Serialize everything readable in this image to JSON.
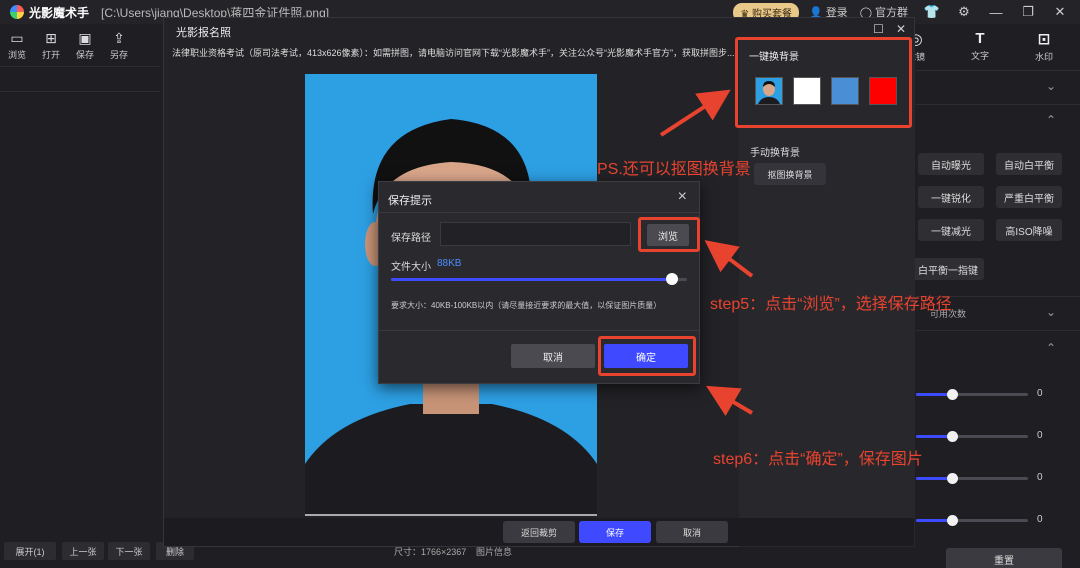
{
  "titlebar": {
    "app_name": "光影魔术手",
    "file_path": "[C:\\Users\\jiang\\Desktop\\蒋四金证件照.png]",
    "vip_label": "购买套餐",
    "login_label": "登录",
    "group_label": "官方群"
  },
  "toolbar": {
    "items": [
      {
        "label": "浏览",
        "icon": "folder-icon"
      },
      {
        "label": "打开",
        "icon": "open-image-icon"
      },
      {
        "label": "保存",
        "icon": "save-icon"
      },
      {
        "label": "另存",
        "icon": "save-as-icon"
      }
    ]
  },
  "right_panel": {
    "tools": [
      {
        "label": "滤镜",
        "icon": "filter-icon"
      },
      {
        "label": "文字",
        "icon": "text-icon"
      },
      {
        "label": "水印",
        "icon": "watermark-icon"
      }
    ],
    "buttons": [
      "自动曝光",
      "自动白平衡",
      "一键锐化",
      "严重白平衡",
      "一键减光",
      "高ISO降噪"
    ],
    "wb_button": "白平衡一指键",
    "usage_note": "可用次数",
    "slider_values": [
      "0",
      "0",
      "0",
      "0"
    ],
    "reset_label": "重置"
  },
  "bottom": {
    "expand_label": "展开(1)",
    "prev_label": "上一张",
    "next_label": "下一张",
    "delete_label": "删除",
    "size_info": "尺寸：1766×2367",
    "img_info": "图片信息"
  },
  "photo_dialog": {
    "title": "光影报名照",
    "notice": "法律职业资格考试（原司法考试，413x626像素）：如需拼图，请电脑访问官网下载“光影魔术手”，关注公众号“光影魔术手官方”，获取拼图步...",
    "onekey_title": "一键换背景",
    "swatches": [
      "#ffffff",
      "#4a8fd6",
      "#ff0000"
    ],
    "manual_title": "手动换背景",
    "cutout_label": "抠图换背景",
    "back_label": "返回裁剪",
    "save_label": "保存",
    "cancel_label": "取消"
  },
  "save_dialog": {
    "title": "保存提示",
    "path_label": "保存路径",
    "path_value": "",
    "browse_label": "浏览",
    "size_label": "文件大小",
    "size_value": "88KB",
    "quality_percent": 95,
    "requirement": "要求大小：40KB-100KB以内（请尽量接近要求的最大值，以保证图片质量）",
    "cancel_label": "取消",
    "ok_label": "确定"
  },
  "annotations": {
    "ps_note": "PS.还可以抠图换背景",
    "step5": "step5：点击“浏览”，选择保存路径",
    "step6": "step6：点击“确定”，保存图片"
  },
  "colors": {
    "accent": "#3f49ff",
    "annotation_red": "#e8432f",
    "photo_bg": "#2d9fe3"
  }
}
